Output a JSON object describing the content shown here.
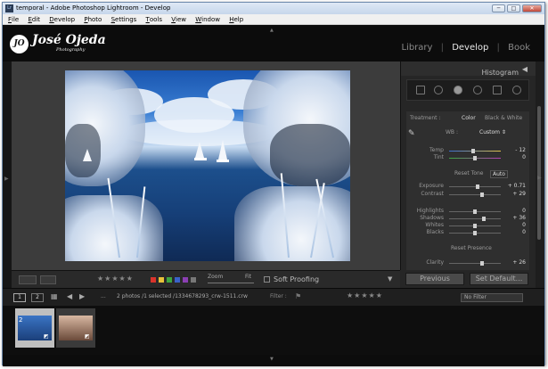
{
  "window": {
    "title": "temporal - Adobe Photoshop Lightroom - Develop",
    "app_icon": "Lr"
  },
  "window_controls": [
    "─",
    "□",
    "✕"
  ],
  "menu": [
    {
      "label": "File",
      "key": "F",
      "rest": "ile"
    },
    {
      "label": "Edit",
      "key": "E",
      "rest": "dit"
    },
    {
      "label": "Develop",
      "key": "D",
      "rest": "evelop"
    },
    {
      "label": "Photo",
      "key": "P",
      "rest": "hoto"
    },
    {
      "label": "Settings",
      "key": "S",
      "rest": "ettings"
    },
    {
      "label": "Tools",
      "key": "T",
      "rest": "ools"
    },
    {
      "label": "View",
      "key": "V",
      "rest": "iew"
    },
    {
      "label": "Window",
      "key": "W",
      "rest": "indow"
    },
    {
      "label": "Help",
      "key": "H",
      "rest": "elp"
    }
  ],
  "identity_plate": {
    "monogram": "JO",
    "name": "José Ojeda",
    "tagline": "Photography"
  },
  "modules": [
    "Library",
    "Develop",
    "Book"
  ],
  "active_module": "Develop",
  "right_panel": {
    "histogram_label": "Histogram",
    "treatment_label": "Treatment :",
    "color_label": "Color",
    "bw_label": "Black & White",
    "wb_label": "WB :",
    "wb_value": "Custom",
    "tone_label": "Reset Tone",
    "auto_label": "Auto",
    "presence_label": "Reset Presence",
    "sliders": [
      {
        "name": "Temp",
        "value": "- 12",
        "pos": 0.47
      },
      {
        "name": "Tint",
        "value": "0",
        "pos": 0.5
      },
      {
        "name": "Exposure",
        "value": "+ 0.71",
        "pos": 0.55
      },
      {
        "name": "Contrast",
        "value": "+ 29",
        "pos": 0.64
      },
      {
        "name": "Highlights",
        "value": "0",
        "pos": 0.5
      },
      {
        "name": "Shadows",
        "value": "+ 36",
        "pos": 0.68
      },
      {
        "name": "Whites",
        "value": "0",
        "pos": 0.5
      },
      {
        "name": "Blacks",
        "value": "0",
        "pos": 0.5
      },
      {
        "name": "Clarity",
        "value": "+ 26",
        "pos": 0.63
      }
    ],
    "previous_button": "Previous",
    "set_default_button": "Set Default..."
  },
  "toolbar": {
    "stars": "★★★★★",
    "zoom_label": "Zoom",
    "fit_label": "Fit",
    "soft_proofing_label": "Soft Proofing",
    "color_labels": [
      "#d9332b",
      "#e8c23a",
      "#3da640",
      "#3a62c9",
      "#8b3fb3",
      "#777777"
    ]
  },
  "filmstrip": {
    "pages": [
      "1",
      "2"
    ],
    "info": "2 photos /1 selected /1334678293_crw-1511.crw",
    "filter_label": "Filter :",
    "filter_stars": "★★★★★",
    "no_filter_label": "No Filter",
    "thumb_badge": "2"
  }
}
